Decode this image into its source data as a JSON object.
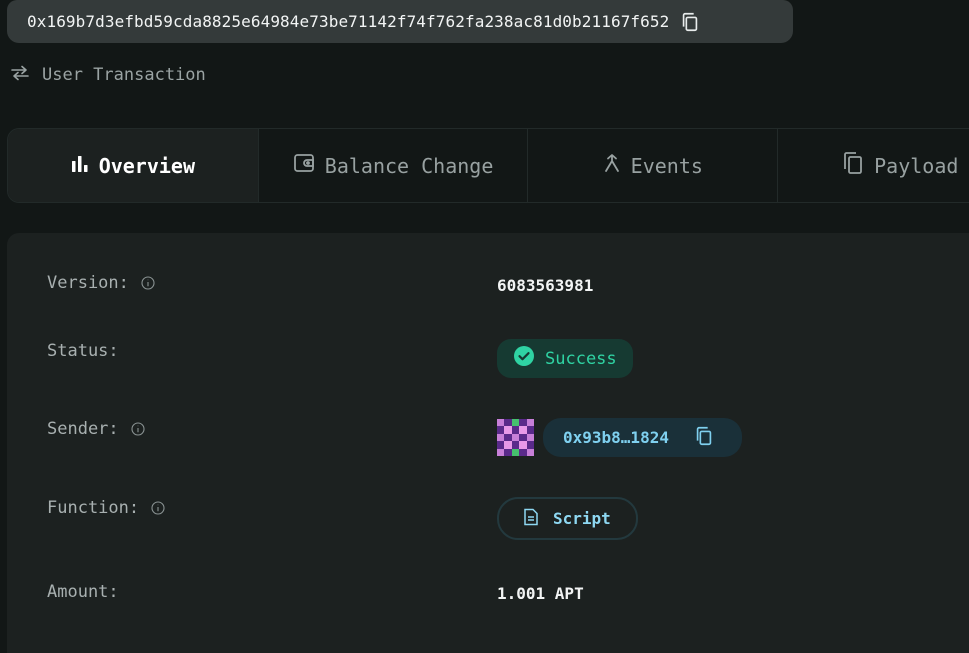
{
  "header": {
    "tx_hash": "0x169b7d3efbd59cda8825e64984e73be71142f74f762fa238ac81d0b21167f652",
    "tx_type": "User Transaction"
  },
  "tabs": [
    {
      "label": "Overview",
      "icon": "bar-chart-icon",
      "active": true
    },
    {
      "label": "Balance Change",
      "icon": "wallet-icon",
      "active": false
    },
    {
      "label": "Events",
      "icon": "merge-arrow-icon",
      "active": false
    },
    {
      "label": "Payload",
      "icon": "copy-document-icon",
      "active": false
    }
  ],
  "overview": {
    "version": {
      "label": "Version:",
      "value": "6083563981"
    },
    "status": {
      "label": "Status:",
      "value": "Success"
    },
    "sender": {
      "label": "Sender:",
      "value": "0x93b8…1824"
    },
    "function": {
      "label": "Function:",
      "value": "Script"
    },
    "amount": {
      "label": "Amount:",
      "value": "1.001 APT"
    }
  },
  "colors": {
    "success": "#2fd3a3",
    "accent": "#7fd0ef",
    "background": "#121716",
    "panel": "#1c2120"
  }
}
